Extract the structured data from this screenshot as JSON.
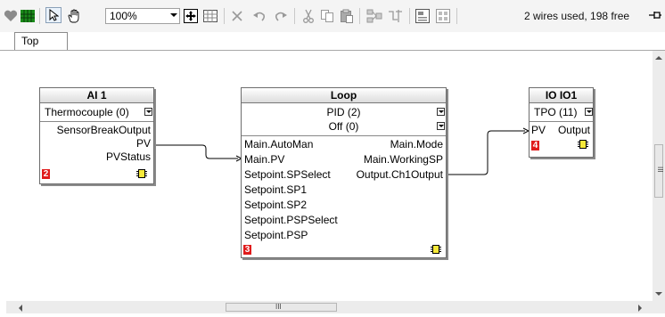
{
  "toolbar": {
    "zoom": "100%",
    "status": "2 wires used, 198 free"
  },
  "tabs": [
    {
      "label": "Top"
    }
  ],
  "blocks": {
    "ai1": {
      "title": "AI 1",
      "mode": "Thermocouple (0)",
      "outputs": [
        "SensorBreakOutput",
        "PV",
        "PVStatus"
      ],
      "exec_order": "2"
    },
    "loop": {
      "title": "Loop",
      "type": "PID (2)",
      "state": "Off (0)",
      "left_params": [
        "Main.AutoMan",
        "Main.PV",
        "Setpoint.SPSelect",
        "Setpoint.SP1",
        "Setpoint.SP2",
        "Setpoint.PSPSelect",
        "Setpoint.PSP"
      ],
      "right_params": [
        "Main.Mode",
        "Main.WorkingSP",
        "Output.Ch1Output"
      ],
      "exec_order": "3"
    },
    "io1": {
      "title": "IO IO1",
      "mode": "TPO (11)",
      "input": "PV",
      "output": "Output",
      "exec_order": "4"
    }
  },
  "scrollbar": {
    "grip": "III"
  },
  "colors": {
    "exec_red": "#e01b1b",
    "exec_yellow": "#f6e93a",
    "green": "#2aa52a"
  }
}
